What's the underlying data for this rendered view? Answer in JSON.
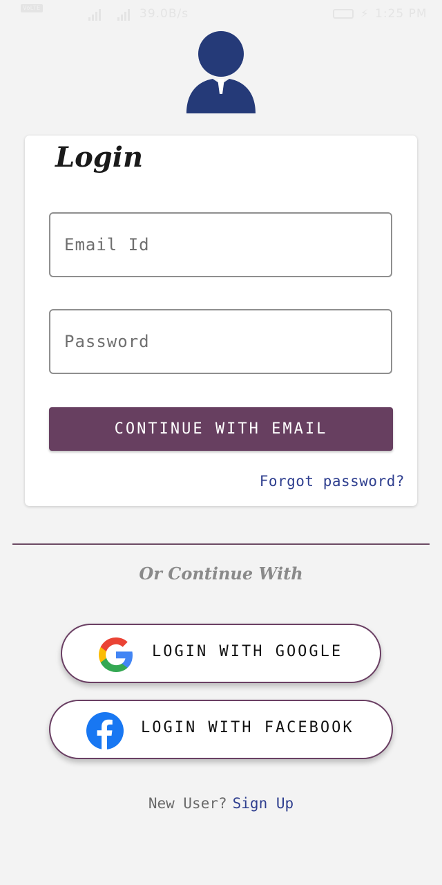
{
  "status_bar": {
    "carrier_line1": "",
    "carrier_line2": "",
    "volte_badge": "VoLTE",
    "net_speed": "39.0B/s",
    "battery": "",
    "clock": "1:25 PM",
    "text_color": "#e4e4e4"
  },
  "avatar": {
    "icon": "user-avatar-icon",
    "color": "#253a78"
  },
  "login_card": {
    "title": "Login",
    "email_placeholder": "Email Id",
    "email_value": "",
    "password_placeholder": "Password",
    "password_value": "",
    "continue_label": "CONTINUE WITH EMAIL",
    "continue_color": "#673f60",
    "forgot_label": "Forgot password?",
    "link_color": "#2f3f8f"
  },
  "divider_text": "Or Continue With",
  "social": {
    "google_label": "LOGIN WITH GOOGLE",
    "google_icon": "google-logo-icon",
    "facebook_label": "LOGIN WITH FACEBOOK",
    "facebook_icon": "facebook-logo-icon",
    "border_color": "#6a3f63"
  },
  "footer": {
    "new_user_text": "New User?",
    "signup_label": "Sign Up"
  }
}
